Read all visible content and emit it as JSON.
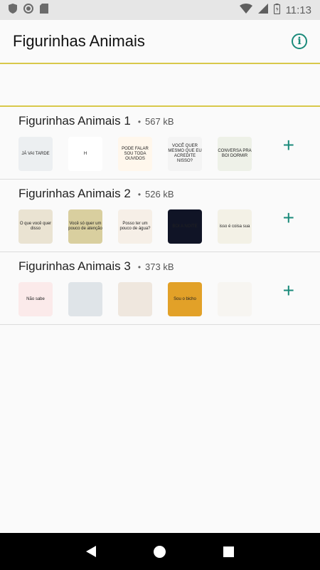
{
  "status_bar": {
    "time": "11:13"
  },
  "app_bar": {
    "title": "Figurinhas Animais",
    "info_icon": "info-icon"
  },
  "packs": [
    {
      "name": "Figurinhas Animais 1",
      "separator": "•",
      "size": "567 kB",
      "stickers": [
        {
          "caption": "JÁ VAI TARDE",
          "bg": "#eceff1"
        },
        {
          "caption": "H",
          "bg": "#ffffff"
        },
        {
          "caption": "PODE FALAR SOU TODA OUVIDOS",
          "bg": "#fff7ec"
        },
        {
          "caption": "VOCÊ QUER MESMO QUE EU ACREDITE NISSO?",
          "bg": "#f4f4f4"
        },
        {
          "caption": "CONVERSA PRA BOI DORMIR",
          "bg": "#eef1e8"
        }
      ]
    },
    {
      "name": "Figurinhas Animais 2",
      "separator": "•",
      "size": "526 kB",
      "stickers": [
        {
          "caption": "O que você quer disso",
          "bg": "#eae3d2"
        },
        {
          "caption": "Você só quer um pouco de atenção",
          "bg": "#d9cf9f"
        },
        {
          "caption": "Posso ter um pouco de água?",
          "bg": "#f6efe7"
        },
        {
          "caption": "BOI A NOITE",
          "bg": "#101426"
        },
        {
          "caption": "isso é coisa sua",
          "bg": "#f3f1e6"
        }
      ]
    },
    {
      "name": "Figurinhas Animais 3",
      "separator": "•",
      "size": "373 kB",
      "stickers": [
        {
          "caption": "Não sabe",
          "bg": "#fbeaea"
        },
        {
          "caption": "",
          "bg": "#dfe4e8"
        },
        {
          "caption": "",
          "bg": "#efe7de"
        },
        {
          "caption": "Sou o bicho",
          "bg": "#e2a128"
        },
        {
          "caption": "",
          "bg": "#f7f5f1"
        }
      ]
    }
  ]
}
